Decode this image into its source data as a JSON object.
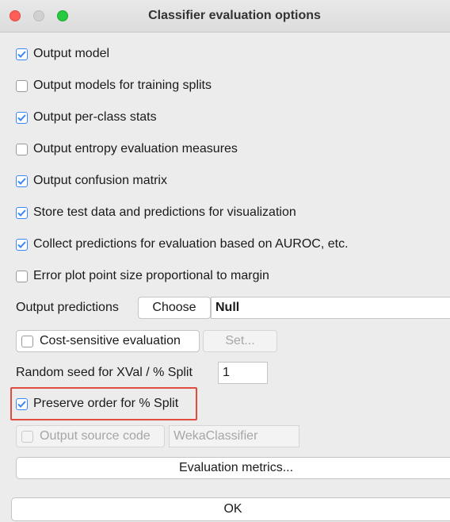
{
  "window": {
    "title": "Classifier evaluation options"
  },
  "checkboxes": [
    {
      "label": "Output model",
      "checked": true
    },
    {
      "label": "Output models for training splits",
      "checked": false
    },
    {
      "label": "Output per-class stats",
      "checked": true
    },
    {
      "label": "Output entropy evaluation measures",
      "checked": false
    },
    {
      "label": "Output confusion matrix",
      "checked": true
    },
    {
      "label": "Store test data and predictions for visualization",
      "checked": true
    },
    {
      "label": "Collect predictions for evaluation based on AUROC, etc.",
      "checked": true
    },
    {
      "label": "Error plot point size proportional to margin",
      "checked": false
    }
  ],
  "output_predictions": {
    "label": "Output predictions",
    "button": "Choose",
    "value": "Null"
  },
  "cost_sensitive": {
    "label": "Cost-sensitive evaluation",
    "checked": false,
    "button": "Set..."
  },
  "random_seed": {
    "label": "Random seed for XVal / % Split",
    "value": "1"
  },
  "preserve_order": {
    "label": "Preserve order for % Split",
    "checked": true
  },
  "output_source": {
    "label": "Output source code",
    "checked": false,
    "value": "WekaClassifier"
  },
  "evaluation_metrics_button": "Evaluation metrics...",
  "ok_button": "OK",
  "colors": {
    "accent": "#3a86ff",
    "highlight": "#e24c3f"
  }
}
